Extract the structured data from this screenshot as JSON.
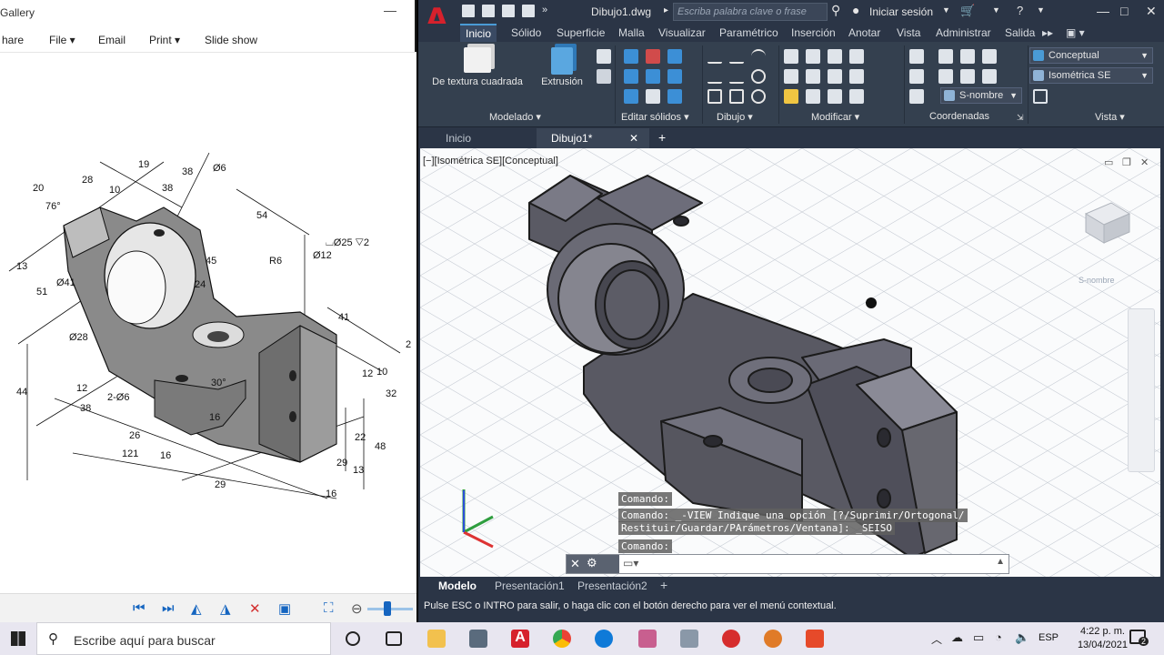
{
  "gallery": {
    "title": "Gallery",
    "menu": [
      "hare",
      "File ▾",
      "Email",
      "Print ▾",
      "Slide show"
    ],
    "drawing_dimensions": [
      "13",
      "20",
      "76°",
      "28",
      "10",
      "19",
      "38",
      "38",
      "Ø6",
      "54",
      "Ø12",
      "⌴Ø25 ▽2",
      "R6",
      "45",
      "Ø41",
      "51",
      "Ø28",
      "24",
      "41",
      "2",
      "12",
      "10",
      "32",
      "44",
      "12",
      "38",
      "2-Ø6",
      "30°",
      "16",
      "22",
      "48",
      "121",
      "16",
      "13",
      "29",
      "29",
      "16",
      "26"
    ]
  },
  "acad": {
    "file": "Dibujo1.dwg",
    "search_placeholder": "Escriba palabra clave o frase",
    "login": "Iniciar sesión",
    "tabs": [
      "Inicio",
      "Sólido",
      "Superficie",
      "Malla",
      "Visualizar",
      "Paramétrico",
      "Inserción",
      "Anotar",
      "Vista",
      "Administrar",
      "Salida"
    ],
    "ribbon": {
      "big_buttons": [
        "De textura cuadrada",
        "Extrusión"
      ],
      "panels": [
        "Modelado ▾",
        "Editar sólidos ▾",
        "Dibujo ▾",
        "Modificar ▾",
        "Coordenadas",
        "Vista ▾"
      ],
      "visual_style": "Conceptual",
      "view": "Isométrica SE",
      "ucs": "S-nombre"
    },
    "file_tabs": [
      "Inicio",
      "Dibujo1*"
    ],
    "viewport_label": "[−][Isométrica SE][Conceptual]",
    "viewcube_label": "S-nombre",
    "command_history": [
      "Comando:",
      "Comando: _-VIEW Indique una opción [?/Suprimir/Ortogonal/",
      "Restituir/Guardar/PArámetros/Ventana]: _SEISO",
      "Comando:"
    ],
    "layout_tabs": [
      "Modelo",
      "Presentación1",
      "Presentación2"
    ],
    "status_text": "Pulse ESC o INTRO para salir, o haga clic con el botón derecho para ver el menú contextual."
  },
  "taskbar": {
    "search_text": "Escribe aquí para buscar",
    "language": "ESP",
    "time": "4:22 p. m.",
    "date": "13/04/2021",
    "notification_count": "2"
  }
}
